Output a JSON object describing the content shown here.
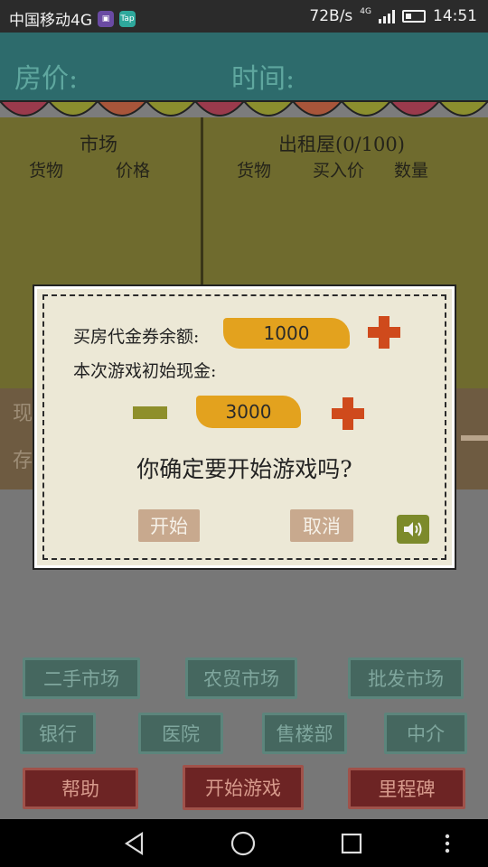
{
  "status_bar": {
    "carrier": "中国移动4G",
    "net_speed": "72B/s",
    "network_badge": "4G",
    "time": "14:51",
    "app_icons": [
      "gallery-icon",
      "taptap-icon"
    ],
    "tap_label": "Tap"
  },
  "header": {
    "price_label": "房价:",
    "time_label": "时间:"
  },
  "market": {
    "title": "市场",
    "col_goods": "货物",
    "col_price": "价格"
  },
  "rental": {
    "title": "出租屋(0/100)",
    "col_goods": "货物",
    "col_buy_price": "买入价",
    "col_quantity": "数量"
  },
  "side_labels": {
    "cash": "现",
    "deposit": "存"
  },
  "dialog": {
    "voucher_label": "买房代金券余额:",
    "voucher_value": "1000",
    "cash_label": "本次游戏初始现金:",
    "cash_value": "3000",
    "question": "你确定要开始游戏吗?",
    "start_label": "开始",
    "cancel_label": "取消"
  },
  "menu": {
    "second_hand": "二手市场",
    "farm_market": "农贸市场",
    "wholesale": "批发市场",
    "bank": "银行",
    "hospital": "医院",
    "sales_dept": "售楼部",
    "agency": "中介",
    "help": "帮助",
    "start_game": "开始游戏",
    "milestone": "里程碑"
  },
  "colors": {
    "header": "#2d6b6c",
    "board": "#6f6b2e",
    "dialog_bg": "#ece8d6",
    "pill": "#e3a21e",
    "plus": "#cf4a1c",
    "minus": "#8e8f2b"
  }
}
